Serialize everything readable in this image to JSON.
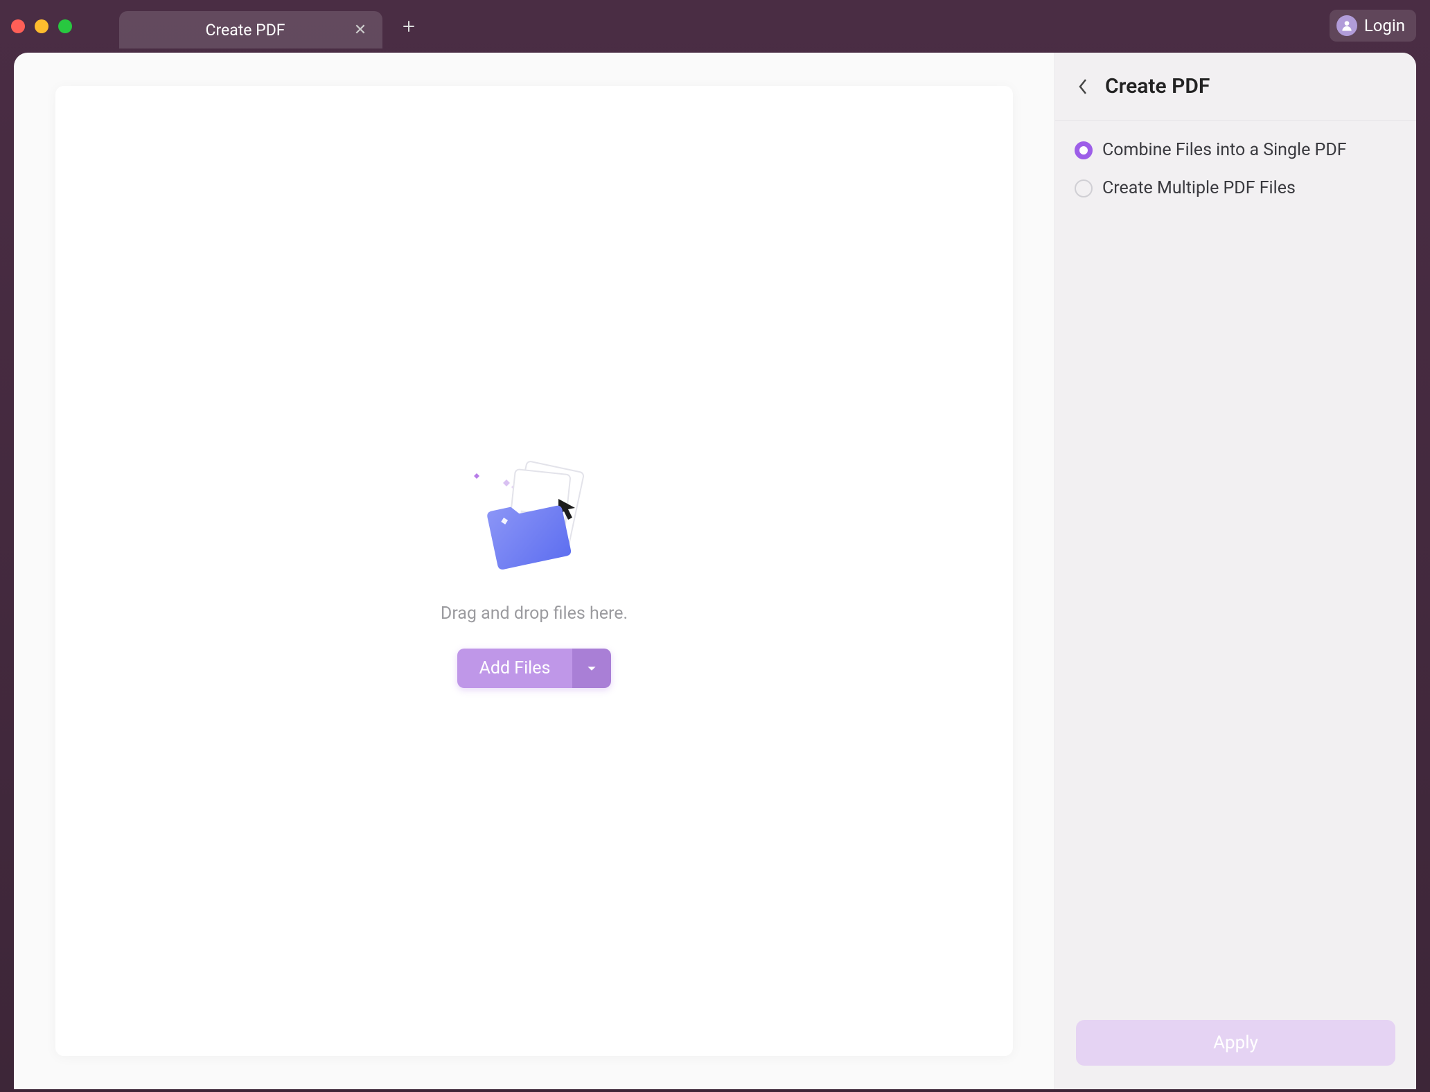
{
  "titlebar": {
    "tab_title": "Create PDF",
    "login_label": "Login"
  },
  "main": {
    "drop_hint": "Drag and drop files here.",
    "add_files_label": "Add Files"
  },
  "side": {
    "title": "Create PDF",
    "options": [
      {
        "label": "Combine Files into a Single PDF",
        "selected": true
      },
      {
        "label": "Create Multiple PDF Files",
        "selected": false
      }
    ],
    "apply_label": "Apply"
  }
}
